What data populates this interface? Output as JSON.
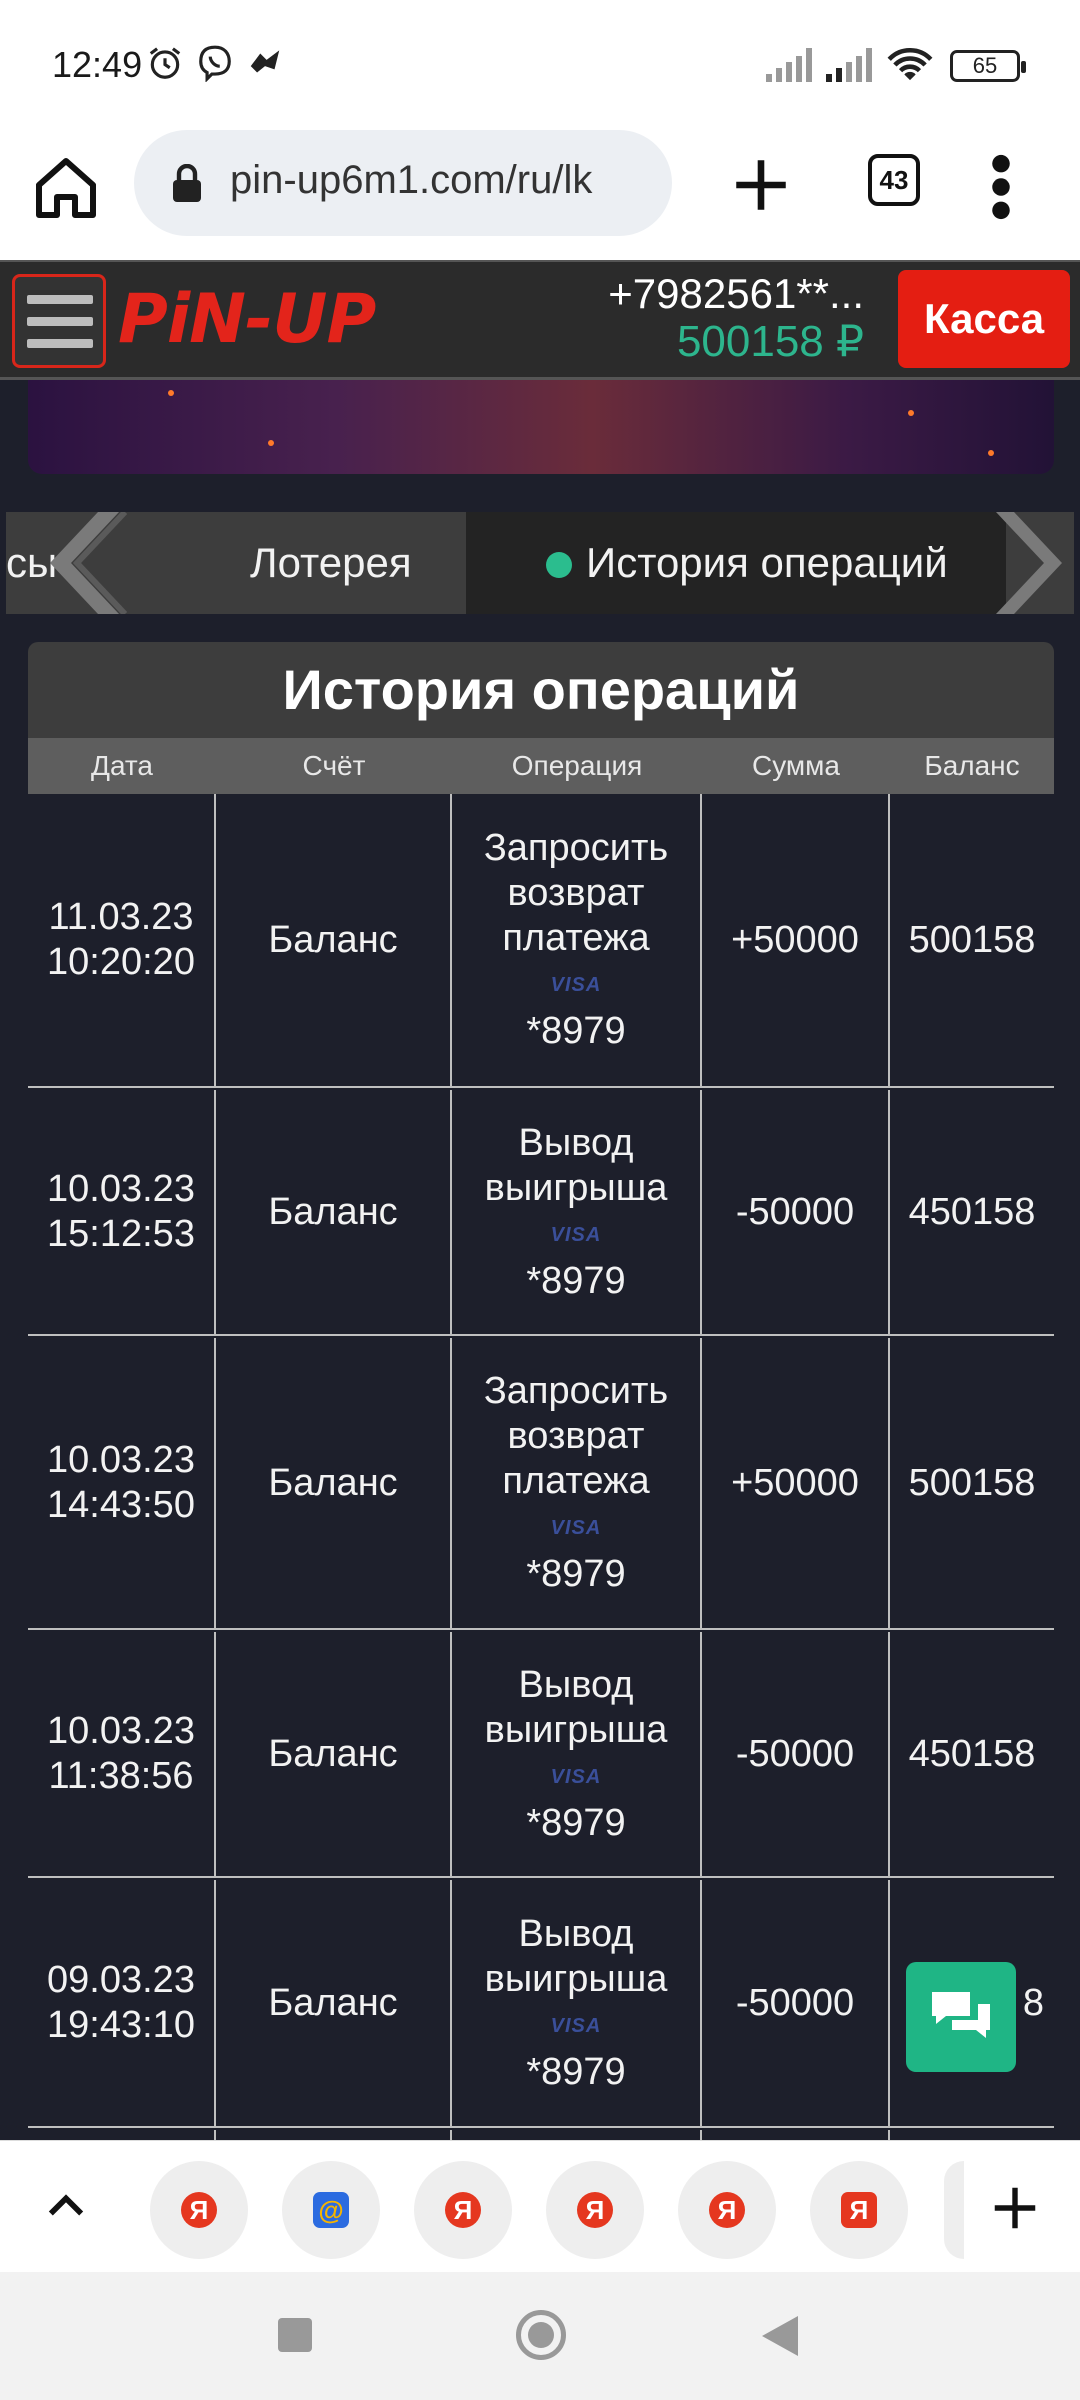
{
  "status": {
    "time": "12:49",
    "battery": "65"
  },
  "browser": {
    "url": "pin-up6m1.com/ru/lk",
    "tab_count": "43"
  },
  "header": {
    "logo": "PiN-UP",
    "phone": "+7982561**...",
    "balance": "500158 ₽",
    "kassa_label": "Касса"
  },
  "tabs": {
    "partial": "сы",
    "lottery": "Лотерея",
    "history": "История операций"
  },
  "table": {
    "title": "История операций",
    "columns": [
      "Дата",
      "Счёт",
      "Операция",
      "Сумма",
      "Баланс"
    ],
    "rows": [
      {
        "date": "11.03.23",
        "time": "10:20:20",
        "account": "Баланс",
        "op": [
          "Запросить",
          "возврат",
          "платежа"
        ],
        "card_brand": "VISA",
        "card": "*8979",
        "amount": "+50000",
        "balance": "500158"
      },
      {
        "date": "10.03.23",
        "time": "15:12:53",
        "account": "Баланс",
        "op": [
          "Вывод",
          "выигрыша"
        ],
        "card_brand": "VISA",
        "card": "*8979",
        "amount": "-50000",
        "balance": "450158"
      },
      {
        "date": "10.03.23",
        "time": "14:43:50",
        "account": "Баланс",
        "op": [
          "Запросить",
          "возврат",
          "платежа"
        ],
        "card_brand": "VISA",
        "card": "*8979",
        "amount": "+50000",
        "balance": "500158"
      },
      {
        "date": "10.03.23",
        "time": "11:38:56",
        "account": "Баланс",
        "op": [
          "Вывод",
          "выигрыша"
        ],
        "card_brand": "VISA",
        "card": "*8979",
        "amount": "-50000",
        "balance": "450158"
      },
      {
        "date": "09.03.23",
        "time": "19:43:10",
        "account": "Баланс",
        "op": [
          "Вывод",
          "выигрыша"
        ],
        "card_brand": "VISA",
        "card": "*8979",
        "amount": "-50000",
        "balance": "8"
      }
    ]
  },
  "bookmarks": [
    {
      "icon": "yandex-icon",
      "glyph": "Я"
    },
    {
      "icon": "mail-icon",
      "glyph": "@"
    },
    {
      "icon": "yandex-icon",
      "glyph": "Я"
    },
    {
      "icon": "yandex-icon",
      "glyph": "Я"
    },
    {
      "icon": "yandex-icon",
      "glyph": "Я"
    },
    {
      "icon": "yandex-browser-icon",
      "glyph": "Я"
    }
  ],
  "colors": {
    "brand_red": "#e41e12",
    "accent_green": "#2db58d",
    "content_bg": "#1d1f2b"
  }
}
